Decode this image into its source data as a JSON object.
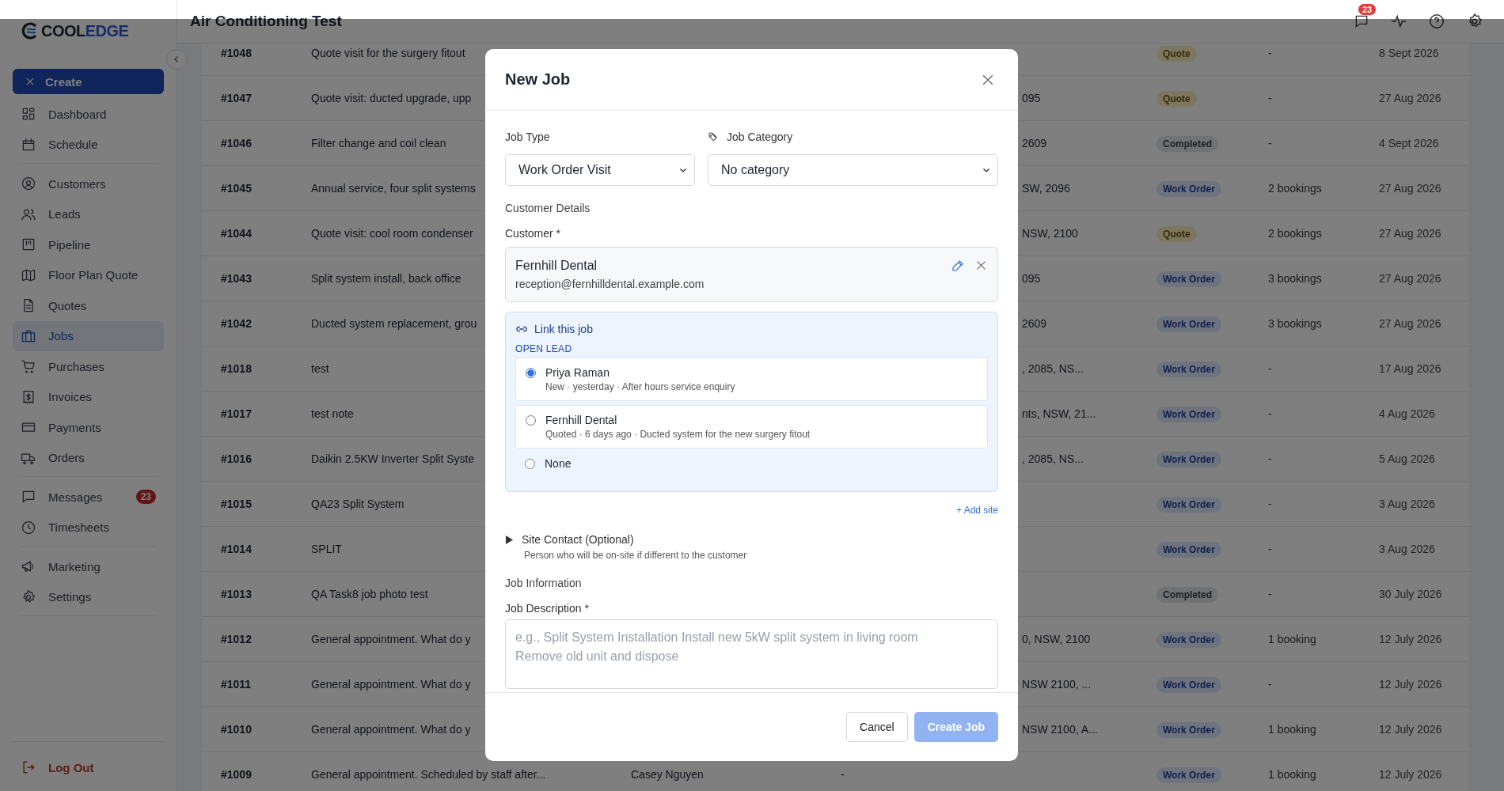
{
  "app": {
    "logo_dark": "COOL",
    "logo_accent": "EDGE",
    "page_title": "Air Conditioning Test",
    "notification_count": "23"
  },
  "sidebar": {
    "create_label": "Create",
    "groups": [
      {
        "items": [
          {
            "label": "Dashboard",
            "selected": false
          },
          {
            "label": "Schedule",
            "selected": false
          }
        ]
      },
      {
        "items": [
          {
            "label": "Customers",
            "selected": false
          },
          {
            "label": "Leads",
            "selected": false
          },
          {
            "label": "Pipeline",
            "selected": false
          },
          {
            "label": "Floor Plan Quote",
            "selected": false
          },
          {
            "label": "Quotes",
            "selected": false
          },
          {
            "label": "Jobs",
            "selected": true
          },
          {
            "label": "Purchases",
            "selected": false
          },
          {
            "label": "Invoices",
            "selected": false
          },
          {
            "label": "Payments",
            "selected": false
          },
          {
            "label": "Orders",
            "selected": false
          }
        ]
      },
      {
        "items": [
          {
            "label": "Messages",
            "selected": false,
            "badge": "23"
          },
          {
            "label": "Timesheets",
            "selected": false
          }
        ]
      },
      {
        "items": [
          {
            "label": "Marketing",
            "selected": false
          },
          {
            "label": "Settings",
            "selected": false
          }
        ]
      }
    ],
    "logout": "Log Out"
  },
  "table": {
    "rows": [
      {
        "id": "#1048",
        "description": "Quote visit for the surgery fitout",
        "status": {
          "label": "Quote",
          "kind": "quote"
        },
        "bookings": "-",
        "date": "8 Sept 2026"
      },
      {
        "id": "#1047",
        "description": "Quote visit: ducted upgrade, upp",
        "address": "095",
        "status": {
          "label": "Quote",
          "kind": "quote"
        },
        "bookings": "-",
        "date": "27 Aug 2026"
      },
      {
        "id": "#1046",
        "description": "Filter change and coil clean",
        "address": "2609",
        "status": {
          "label": "Completed",
          "kind": "completed"
        },
        "bookings": "-",
        "date": "4 Sept 2026"
      },
      {
        "id": "#1045",
        "description": "Annual service, four split systems",
        "address": "SW, 2096",
        "status": {
          "label": "Work Order",
          "kind": "work_order"
        },
        "bookings": "2 bookings",
        "date": "27 Aug 2026"
      },
      {
        "id": "#1044",
        "description": "Quote visit: cool room condenser",
        "address": "NSW, 2100",
        "status": {
          "label": "Quote",
          "kind": "quote"
        },
        "bookings": "2 bookings",
        "date": "27 Aug 2026"
      },
      {
        "id": "#1043",
        "description": "Split system install, back office",
        "address": "095",
        "status": {
          "label": "Work Order",
          "kind": "work_order"
        },
        "bookings": "3 bookings",
        "date": "27 Aug 2026"
      },
      {
        "id": "#1042",
        "description": "Ducted system replacement, grou",
        "address": "2609",
        "status": {
          "label": "Work Order",
          "kind": "work_order"
        },
        "bookings": "3 bookings",
        "date": "27 Aug 2026"
      },
      {
        "id": "#1018",
        "description": "test",
        "address": ", 2085, NS...",
        "status": {
          "label": "Work Order",
          "kind": "work_order"
        },
        "bookings": "-",
        "date": "17 Aug 2026"
      },
      {
        "id": "#1017",
        "description": "test note",
        "address": "nts, NSW, 21...",
        "status": {
          "label": "Work Order",
          "kind": "work_order"
        },
        "bookings": "-",
        "date": "4 Aug 2026"
      },
      {
        "id": "#1016",
        "description": "Daikin 2.5KW Inverter Split Syste",
        "address": ", 2085, NS...",
        "status": {
          "label": "Work Order",
          "kind": "work_order"
        },
        "bookings": "-",
        "date": "5 Aug 2026"
      },
      {
        "id": "#1015",
        "description": "QA23 Split System",
        "status": {
          "label": "Work Order",
          "kind": "work_order"
        },
        "bookings": "-",
        "date": "3 Aug 2026"
      },
      {
        "id": "#1014",
        "description": "SPLIT",
        "status": {
          "label": "Work Order",
          "kind": "work_order"
        },
        "bookings": "-",
        "date": "3 Aug 2026"
      },
      {
        "id": "#1013",
        "description": "QA Task8 job photo test",
        "status": {
          "label": "Completed",
          "kind": "completed"
        },
        "bookings": "-",
        "date": "30 July 2026"
      },
      {
        "id": "#1012",
        "description": "General appointment. What do y",
        "address": "0, NSW, 2100",
        "status": {
          "label": "Work Order",
          "kind": "work_order"
        },
        "bookings": "1 booking",
        "date": "12 July 2026"
      },
      {
        "id": "#1011",
        "description": "General appointment. What do y",
        "address": "NSW 2100, ...",
        "status": {
          "label": "Work Order",
          "kind": "work_order"
        },
        "bookings": "-",
        "date": "12 July 2026"
      },
      {
        "id": "#1010",
        "description": "General appointment. What do y",
        "address": "NSW 2100, A...",
        "status": {
          "label": "Work Order",
          "kind": "work_order"
        },
        "bookings": "1 booking",
        "date": "12 July 2026"
      },
      {
        "id": "#1009",
        "description": "General appointment. Scheduled by staff after...",
        "customer": "Casey Nguyen",
        "address": "-",
        "status": {
          "label": "Work Order",
          "kind": "work_order"
        },
        "bookings": "1 booking",
        "date": "12 July 2026"
      }
    ]
  },
  "dialog": {
    "title": "New Job",
    "job_type": {
      "label": "Job Type",
      "value": "Work Order Visit"
    },
    "job_category": {
      "label": "Job Category",
      "value": "No category"
    },
    "customer_section": "Customer Details",
    "customer_label": "Customer *",
    "customer": {
      "name": "Fernhill Dental",
      "email": "reception@fernhilldental.example.com"
    },
    "link": {
      "title": "Link this job",
      "group_label": "OPEN LEAD",
      "options": [
        {
          "kind": "lead",
          "title": "Priya Raman",
          "detail": "New · yesterday · After hours service enquiry",
          "selected": true
        },
        {
          "kind": "lead",
          "title": "Fernhill Dental",
          "detail": "Quoted · 6 days ago · Ducted system for the new surgery fitout",
          "selected": false
        },
        {
          "kind": "none",
          "title": "None",
          "selected": false
        }
      ]
    },
    "add_site": "+ Add site",
    "site_contact": {
      "title": "Site Contact (Optional)",
      "hint": "Person who will be on-site if different to the customer",
      "expanded": false
    },
    "job_section": "Job Information",
    "description_label": "Job Description *",
    "description_placeholder": "e.g., Split System Installation Install new 5kW split system in living room\nRemove old unit and dispose",
    "cancel": "Cancel",
    "submit": {
      "label": "Create Job",
      "disabled": true
    }
  }
}
